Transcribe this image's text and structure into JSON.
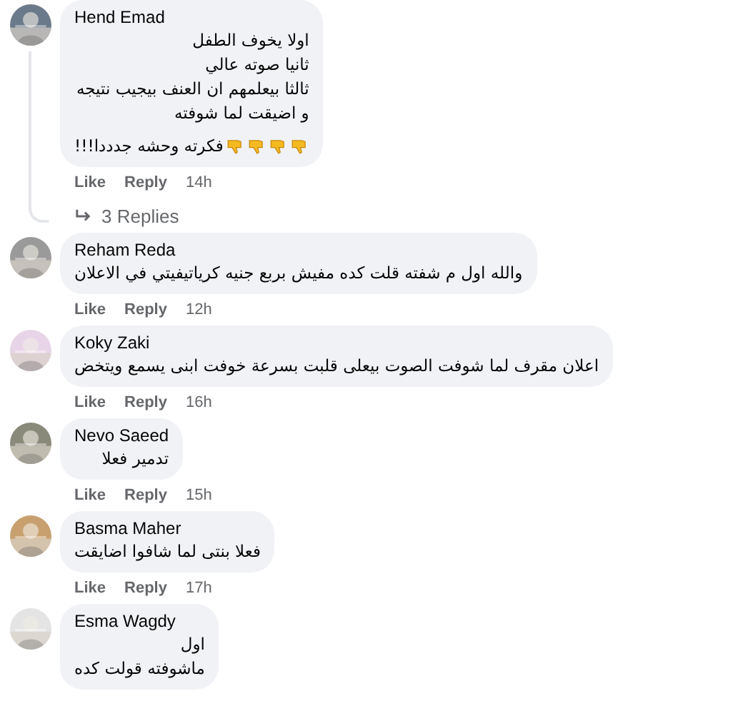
{
  "comments": [
    {
      "author": "Hend Emad",
      "lines": [
        {
          "kind": "text",
          "text": "اولا يخوف الطفل"
        },
        {
          "kind": "text",
          "text": "ثانيا صوته عالي"
        },
        {
          "kind": "text",
          "text": "ثالثا بيعلمهم ان العنف بيجيب نتيجه"
        },
        {
          "kind": "text",
          "text": "و اضيقت لما شوفته"
        },
        {
          "kind": "thumbs_down_line",
          "text": "فكرته وحشه جدددا!!!"
        }
      ],
      "like": "Like",
      "reply": "Reply",
      "time": "14h",
      "replies": "3 Replies"
    },
    {
      "author": "Reham Reda",
      "lines": [
        {
          "kind": "text",
          "text": "والله اول م شفته قلت كده مفيش بربع جنيه كرياتيفيتي في الاعلان"
        }
      ],
      "like": "Like",
      "reply": "Reply",
      "time": "12h"
    },
    {
      "author": "Koky Zaki",
      "lines": [
        {
          "kind": "text",
          "text": "اعلان مقرف لما شوفت الصوت بيعلى قلبت بسرعة خوفت ابنى يسمع ويتخض"
        }
      ],
      "like": "Like",
      "reply": "Reply",
      "time": "16h"
    },
    {
      "author": "Nevo Saeed",
      "lines": [
        {
          "kind": "text",
          "text": "تدمير فعلا"
        }
      ],
      "like": "Like",
      "reply": "Reply",
      "time": "15h"
    },
    {
      "author": "Basma Maher",
      "lines": [
        {
          "kind": "text",
          "text": "فعلا بنتى لما شافوا اضايقت"
        }
      ],
      "like": "Like",
      "reply": "Reply",
      "time": "17h"
    },
    {
      "author": "Esma Wagdy",
      "lines": [
        {
          "kind": "text",
          "text": "اول"
        },
        {
          "kind": "text",
          "text": "ماشوفته قولت كده"
        }
      ]
    }
  ]
}
